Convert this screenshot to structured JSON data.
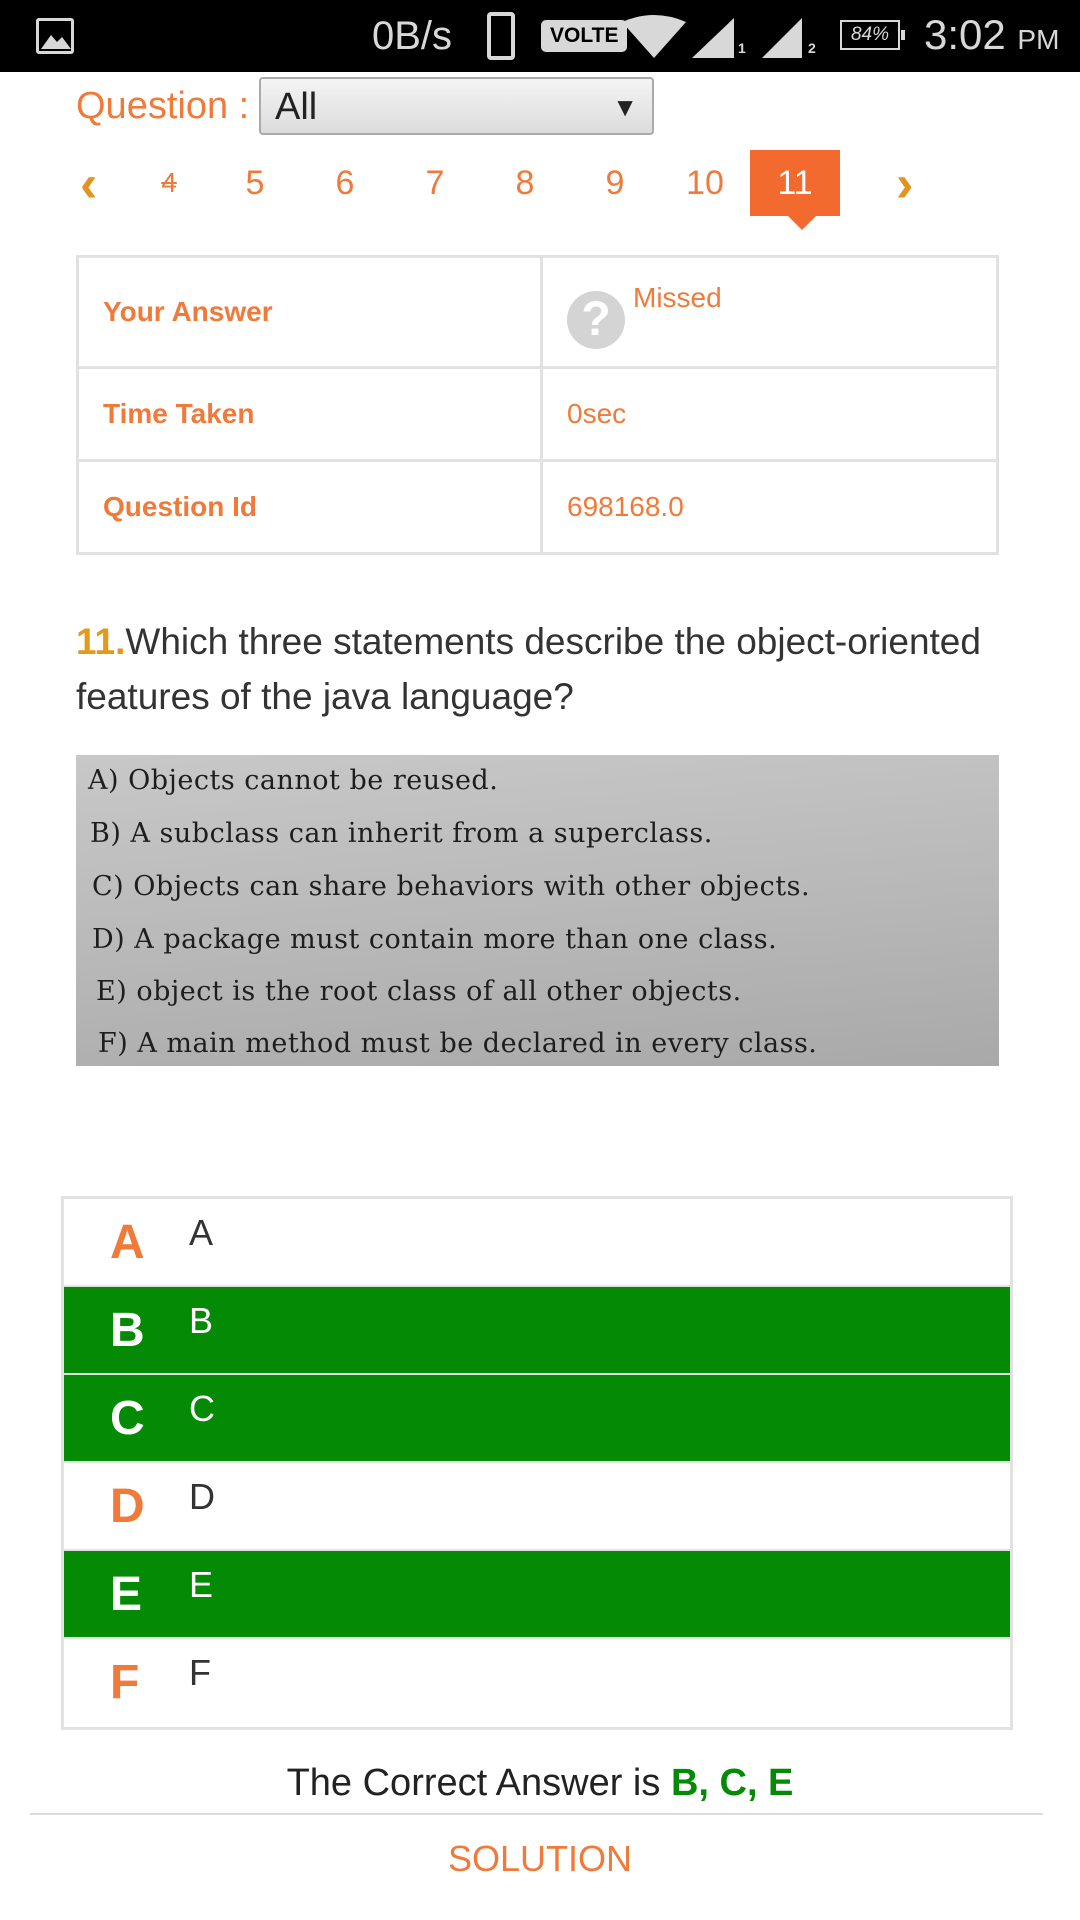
{
  "status_bar": {
    "net_speed": "0B/s",
    "volte": "VOLTE",
    "sim1": "1",
    "sim2": "2",
    "battery": "84%",
    "time": "3:02",
    "ampm": "PM",
    "icons": [
      "gallery-icon",
      "phone-icon",
      "wifi-icon",
      "signal-icon",
      "battery-icon"
    ]
  },
  "question_filter": {
    "label": "Question :",
    "selected": "All"
  },
  "pager": {
    "pages": [
      "4",
      "5",
      "6",
      "7",
      "8",
      "9",
      "10",
      "11"
    ],
    "active": "11"
  },
  "info": {
    "your_answer_label": "Your Answer",
    "your_answer_value": "Missed",
    "time_taken_label": "Time Taken",
    "time_taken_value": "0sec",
    "question_id_label": "Question Id",
    "question_id_value": "698168.0"
  },
  "question": {
    "number": "11.",
    "text": "Which three statements describe the object-oriented features of the java language?"
  },
  "statements": [
    "A) Objects cannot be reused.",
    "B) A subclass can inherit from a superclass.",
    "C) Objects can share behaviors with other objects.",
    "D) A package must contain more than one class.",
    "E) object is the root class of all other objects.",
    "F) A main method must be declared in every class."
  ],
  "options": [
    {
      "letter": "A",
      "text": "A",
      "correct": false
    },
    {
      "letter": "B",
      "text": "B",
      "correct": true
    },
    {
      "letter": "C",
      "text": "C",
      "correct": true
    },
    {
      "letter": "D",
      "text": "D",
      "correct": false
    },
    {
      "letter": "E",
      "text": "E",
      "correct": true
    },
    {
      "letter": "F",
      "text": "F",
      "correct": false
    }
  ],
  "correct_answer": {
    "prefix": "The Correct Answer is",
    "value": "B, C, E"
  },
  "solution_label": "SOLUTION",
  "colors": {
    "accent": "#f07a3a",
    "correct": "#058a05",
    "question_number": "#e39a1a"
  }
}
